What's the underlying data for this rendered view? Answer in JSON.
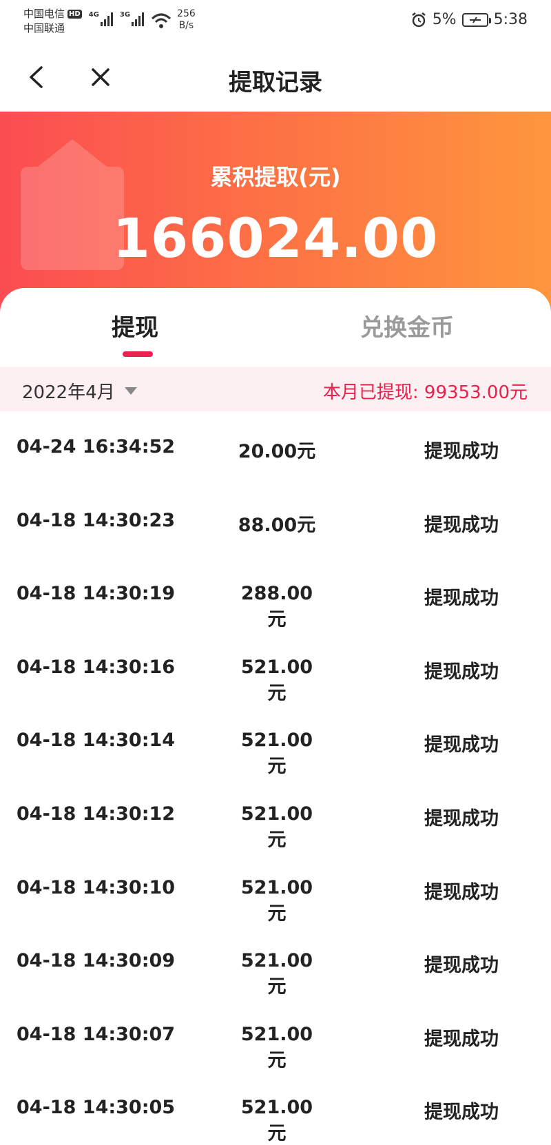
{
  "status_bar": {
    "carrier1": "中国电信",
    "hd": "HD",
    "carrier2": "中国联通",
    "net1": "4G",
    "net2": "3G",
    "speed_value": "256",
    "speed_unit": "B/s",
    "battery": "5%",
    "time": "5:38"
  },
  "nav": {
    "title": "提取记录"
  },
  "banner": {
    "label": "累积提取(元)",
    "amount": "166024.00"
  },
  "tabs": [
    {
      "label": "提现",
      "active": true
    },
    {
      "label": "兑换金币",
      "active": false
    }
  ],
  "filter": {
    "month": "2022年4月",
    "month_total": "本月已提现: 99353.00元"
  },
  "records": [
    {
      "time": "04-24 16:34:52",
      "amount": "20.00元",
      "status": "提现成功"
    },
    {
      "time": "04-18 14:30:23",
      "amount": "88.00元",
      "status": "提现成功"
    },
    {
      "time": "04-18 14:30:19",
      "amount": "288.00元",
      "status": "提现成功"
    },
    {
      "time": "04-18 14:30:16",
      "amount": "521.00元",
      "status": "提现成功"
    },
    {
      "time": "04-18 14:30:14",
      "amount": "521.00元",
      "status": "提现成功"
    },
    {
      "time": "04-18 14:30:12",
      "amount": "521.00元",
      "status": "提现成功"
    },
    {
      "time": "04-18 14:30:10",
      "amount": "521.00元",
      "status": "提现成功"
    },
    {
      "time": "04-18 14:30:09",
      "amount": "521.00元",
      "status": "提现成功"
    },
    {
      "time": "04-18 14:30:07",
      "amount": "521.00元",
      "status": "提现成功"
    },
    {
      "time": "04-18 14:30:05",
      "amount": "521.00元",
      "status": "提现成功"
    }
  ],
  "colors": {
    "accent": "#e8224d",
    "banner_start": "#fb4d52",
    "banner_end": "#fe963d"
  },
  "icons": {
    "back": "chevron-left-icon",
    "close": "close-icon",
    "dropdown": "caret-down-icon",
    "alarm": "alarm-icon",
    "wifi": "wifi-icon",
    "battery": "battery-charging-icon"
  }
}
